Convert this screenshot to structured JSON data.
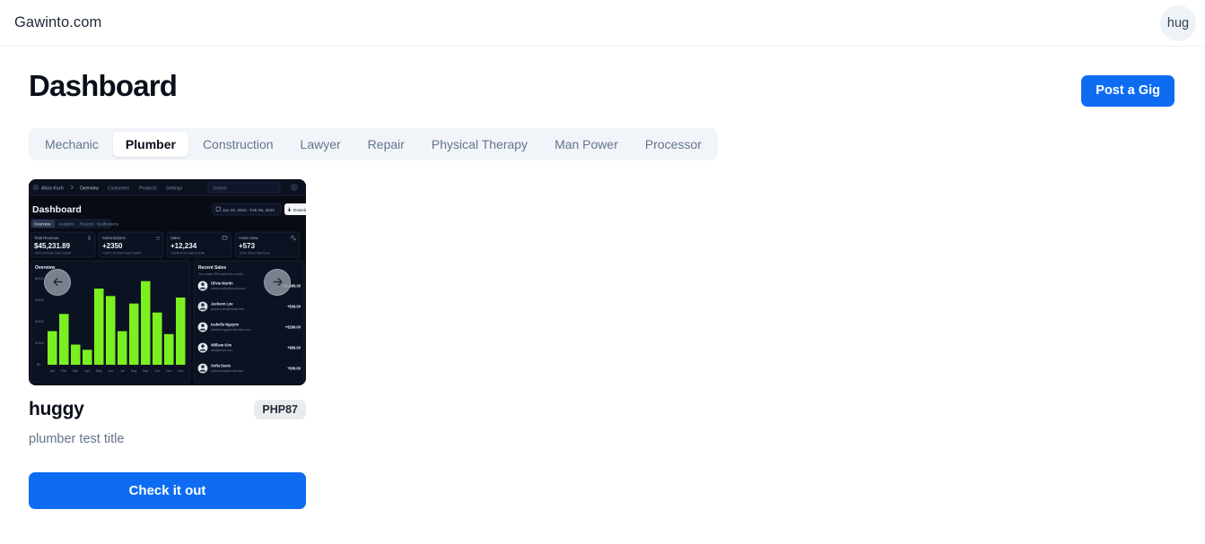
{
  "navbar": {
    "brand": "Gawinto.com",
    "avatar_initials": "hug"
  },
  "page": {
    "title": "Dashboard",
    "post_gig_label": "Post a Gig"
  },
  "tabs": {
    "active": "Plumber",
    "items": [
      {
        "label": "Mechanic"
      },
      {
        "label": "Plumber"
      },
      {
        "label": "Construction"
      },
      {
        "label": "Lawyer"
      },
      {
        "label": "Repair"
      },
      {
        "label": "Physical Therapy"
      },
      {
        "label": "Man Power"
      },
      {
        "label": "Processor"
      }
    ]
  },
  "gig": {
    "title": "huggy",
    "price_badge": "PHP87",
    "description": "plumber test title",
    "cta_label": "Check it out",
    "carousel": {
      "prev_icon": "arrow-left-icon",
      "next_icon": "arrow-right-icon"
    },
    "thumbnail": {
      "alt": "dark analytics dashboard screenshot",
      "nav": {
        "workspace": "Alicia Koch",
        "links": [
          "Overview",
          "Customers",
          "Products",
          "Settings"
        ],
        "search_placeholder": "Search"
      },
      "heading": "Dashboard",
      "date_range": "Jan 20, 2023 - Feb 09, 2023",
      "download_label": "Download",
      "tabs": [
        "Overview",
        "Analytics",
        "Reports",
        "Notifications"
      ],
      "stats": [
        {
          "label": "Total Revenue",
          "value": "$45,231.89",
          "delta": "+20.1% from last month",
          "icon": "currency-icon"
        },
        {
          "label": "Subscriptions",
          "value": "+2350",
          "delta": "+180.1% from last month",
          "icon": "users-icon"
        },
        {
          "label": "Sales",
          "value": "+12,234",
          "delta": "+19% from last month",
          "icon": "card-icon"
        },
        {
          "label": "Active Now",
          "value": "+573",
          "delta": "+201 since last hour",
          "icon": "activity-icon"
        }
      ],
      "chart": {
        "title": "Overview",
        "bar_color": "#7bf020",
        "months": [
          "Jan",
          "Feb",
          "Mar",
          "Apr",
          "May",
          "Jun",
          "Jul",
          "Aug",
          "Sep",
          "Oct",
          "Nov",
          "Dec"
        ],
        "values": [
          2250,
          3400,
          1350,
          1000,
          5100,
          4600,
          2250,
          4100,
          5600,
          3500,
          2050,
          4500
        ],
        "y_ticks": [
          "$0",
          "$1500",
          "$3000",
          "$4500",
          "$6000"
        ]
      },
      "recent_sales": {
        "title": "Recent Sales",
        "subtitle": "You made 265 sales this month.",
        "rows": [
          {
            "name": "Olivia Martin",
            "email": "olivia.martin@email.com",
            "amount": "+$1,999.00"
          },
          {
            "name": "Jackson Lee",
            "email": "jackson.lee@email.com",
            "amount": "+$39.00"
          },
          {
            "name": "Isabella Nguyen",
            "email": "isabella.nguyen@email.com",
            "amount": "+$299.00"
          },
          {
            "name": "William Kim",
            "email": "will@email.com",
            "amount": "+$99.00"
          },
          {
            "name": "Sofia Davis",
            "email": "sofia.davis@email.com",
            "amount": "+$39.00"
          }
        ]
      }
    }
  },
  "colors": {
    "accent_blue": "#0d6cf2",
    "tabbar_bg": "#f1f5f9",
    "badge_bg": "#e9ecef",
    "chart_green": "#7bf020",
    "thumb_bg": "#080b14"
  }
}
